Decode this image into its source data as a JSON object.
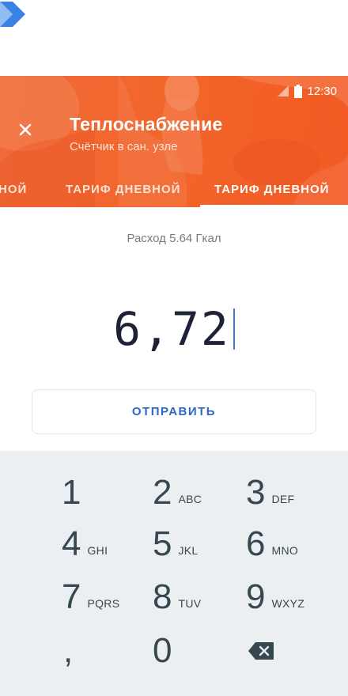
{
  "colors": {
    "header": "#f2662b",
    "accent": "#2b66c9",
    "keyboard": "#eceff1",
    "text_dark": "#1d2236"
  },
  "status_bar": {
    "time": "12:30"
  },
  "header": {
    "close_icon": "close-icon",
    "title": "Теплоснабжение",
    "subtitle": "Счётчик в сан. узле"
  },
  "tabs": [
    {
      "label": "НОЙ",
      "active": false
    },
    {
      "label": "ТАРИФ ДНЕВНОЙ",
      "active": false
    },
    {
      "label": "ТАРИФ ДНЕВНОЙ",
      "active": true
    }
  ],
  "main": {
    "usage": "Расход 5.64 Гкал",
    "reading": "6,72",
    "send_label": "ОТПРАВИТЬ"
  },
  "keyboard": {
    "keys": [
      {
        "digit": "1",
        "letters": ""
      },
      {
        "digit": "2",
        "letters": "ABC"
      },
      {
        "digit": "3",
        "letters": "DEF"
      },
      {
        "digit": "4",
        "letters": "GHI"
      },
      {
        "digit": "5",
        "letters": "JKL"
      },
      {
        "digit": "6",
        "letters": "MNO"
      },
      {
        "digit": "7",
        "letters": "PQRS"
      },
      {
        "digit": "8",
        "letters": "TUV"
      },
      {
        "digit": "9",
        "letters": "WXYZ"
      },
      {
        "digit": ",",
        "letters": ""
      },
      {
        "digit": "0",
        "letters": ""
      }
    ],
    "backspace_icon": "backspace-icon"
  }
}
